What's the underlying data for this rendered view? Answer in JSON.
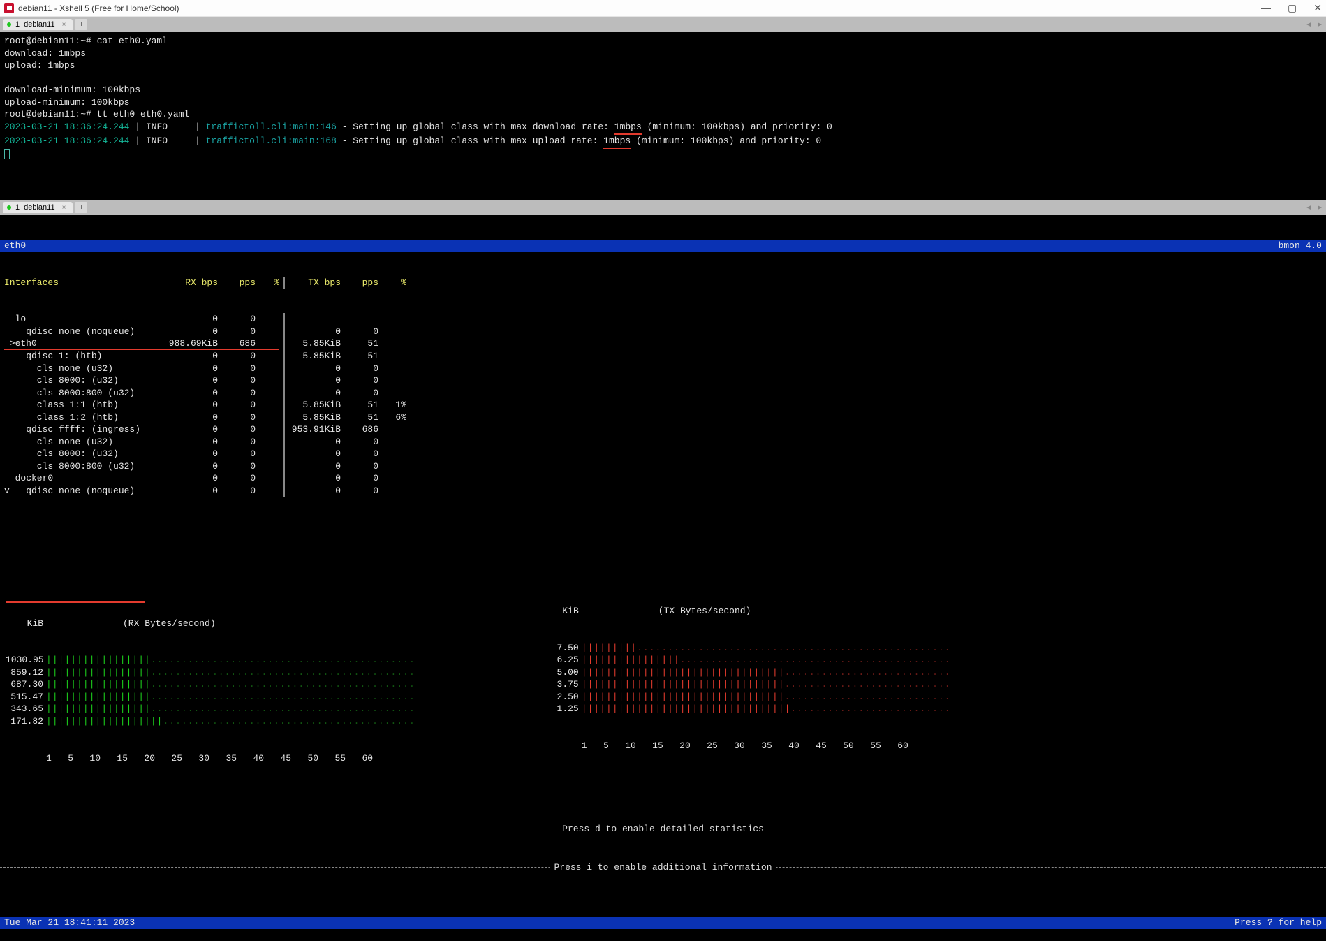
{
  "window": {
    "title": "debian11 - Xshell 5 (Free for Home/School)"
  },
  "tabs_top": {
    "index": "1",
    "name": "debian11"
  },
  "tabs_bottom": {
    "index": "1",
    "name": "debian11"
  },
  "term1": {
    "prompt1": "root@debian11:~# cat eth0.yaml",
    "l1": "download: 1mbps",
    "l2": "upload: 1mbps",
    "l3": "",
    "l4": "download-minimum: 100kbps",
    "l5": "upload-minimum: 100kbps",
    "prompt2": "root@debian11:~# tt eth0 eth0.yaml",
    "log1": {
      "ts": "2023-03-21 18:36:24.244",
      "sep": " | ",
      "lvl": "INFO     ",
      "sep2": "| ",
      "mod": "traffictoll.cli:main:",
      "ln": "146",
      "txt_a": " - Setting up global class with max download rate: ",
      "um": "1mbps",
      "txt_b": " (minimum: 100kbps) and priority: 0"
    },
    "log2": {
      "ts": "2023-03-21 18:36:24.244",
      "sep": " | ",
      "lvl": "INFO     ",
      "sep2": "| ",
      "mod": "traffictoll.cli:main:",
      "ln": "168",
      "txt_a": " - Setting up global class with max upload rate: ",
      "um": "1mbps",
      "txt_b": " (minimum: 100kbps) and priority: 0"
    }
  },
  "bmon": {
    "iface": "eth0",
    "ver": "bmon 4.0",
    "hdr": {
      "c1": "Interfaces",
      "c2": "RX bps",
      "c3": "pps",
      "c4": "%",
      "c5": "TX bps",
      "c6": "pps",
      "c7": "%"
    },
    "rows": [
      {
        "name": "  lo",
        "rb": "0",
        "rp": "0",
        "pc": "",
        "tb": "",
        "tp": "",
        "tc": ""
      },
      {
        "name": "    qdisc none (noqueue)",
        "rb": "0",
        "rp": "0",
        "pc": "",
        "tb": "0",
        "tp": "0",
        "tc": ""
      },
      {
        "name": " >eth0",
        "rb": "988.69KiB",
        "rp": "686",
        "pc": "",
        "tb": "5.85KiB",
        "tp": "51",
        "tc": "",
        "sel": true,
        "red": true
      },
      {
        "name": "    qdisc 1: (htb)",
        "rb": "0",
        "rp": "0",
        "pc": "",
        "tb": "5.85KiB",
        "tp": "51",
        "tc": ""
      },
      {
        "name": "      cls none (u32)",
        "rb": "0",
        "rp": "0",
        "pc": "",
        "tb": "0",
        "tp": "0",
        "tc": ""
      },
      {
        "name": "      cls 8000: (u32)",
        "rb": "0",
        "rp": "0",
        "pc": "",
        "tb": "0",
        "tp": "0",
        "tc": ""
      },
      {
        "name": "      cls 8000:800 (u32)",
        "rb": "0",
        "rp": "0",
        "pc": "",
        "tb": "0",
        "tp": "0",
        "tc": ""
      },
      {
        "name": "      class 1:1 (htb)",
        "rb": "0",
        "rp": "0",
        "pc": "",
        "tb": "5.85KiB",
        "tp": "51",
        "tc": "1%"
      },
      {
        "name": "      class 1:2 (htb)",
        "rb": "0",
        "rp": "0",
        "pc": "",
        "tb": "5.85KiB",
        "tp": "51",
        "tc": "6%"
      },
      {
        "name": "    qdisc ffff: (ingress)",
        "rb": "0",
        "rp": "0",
        "pc": "",
        "tb": "953.91KiB",
        "tp": "686",
        "tc": ""
      },
      {
        "name": "      cls none (u32)",
        "rb": "0",
        "rp": "0",
        "pc": "",
        "tb": "0",
        "tp": "0",
        "tc": ""
      },
      {
        "name": "      cls 8000: (u32)",
        "rb": "0",
        "rp": "0",
        "pc": "",
        "tb": "0",
        "tp": "0",
        "tc": ""
      },
      {
        "name": "      cls 8000:800 (u32)",
        "rb": "0",
        "rp": "0",
        "pc": "",
        "tb": "0",
        "tp": "0",
        "tc": ""
      },
      {
        "name": "  docker0",
        "rb": "0",
        "rp": "0",
        "pc": "",
        "tb": "0",
        "tp": "0",
        "tc": ""
      },
      {
        "name": "v   qdisc none (noqueue)",
        "rb": "0",
        "rp": "0",
        "pc": "",
        "tb": "0",
        "tp": "0",
        "tc": ""
      }
    ],
    "rx": {
      "unit": "KiB",
      "title": "(RX Bytes/second)",
      "ticks": [
        "1030.95",
        "859.12",
        "687.30",
        "515.47",
        "343.65",
        "171.82"
      ],
      "xaxis": "1   5   10   15   20   25   30   35   40   45   50   55   60"
    },
    "tx": {
      "unit": "KiB",
      "title": "(TX Bytes/second)",
      "ticks": [
        "7.50",
        "6.25",
        "5.00",
        "3.75",
        "2.50",
        "1.25"
      ],
      "xaxis": "1   5   10   15   20   25   30   35   40   45   50   55   60"
    },
    "hint1": "Press d to enable detailed statistics",
    "hint2": "Press i to enable additional information",
    "clock": "Tue Mar 21 18:41:11 2023",
    "help": "Press ? for help",
    "chart_data": [
      {
        "type": "bar",
        "title": "RX Bytes/second",
        "ylabel": "KiB",
        "ylim": [
          0,
          1030.95
        ],
        "x": [
          1,
          5,
          10,
          15,
          20,
          25,
          30,
          35,
          40,
          45,
          50,
          55,
          60
        ],
        "series": [
          {
            "name": "RX",
            "values_approx_level": "~1000 KiB for x≈1..17, near 0 afterwards"
          }
        ]
      },
      {
        "type": "bar",
        "title": "TX Bytes/second",
        "ylabel": "KiB",
        "ylim": [
          0,
          7.5
        ],
        "x": [
          1,
          5,
          10,
          15,
          20,
          25,
          30,
          35,
          40,
          45,
          50,
          55,
          60
        ],
        "series": [
          {
            "name": "TX",
            "values_approx_level": "~5–7 KiB for most x≈1..33, sparse/low afterwards"
          }
        ]
      }
    ]
  }
}
